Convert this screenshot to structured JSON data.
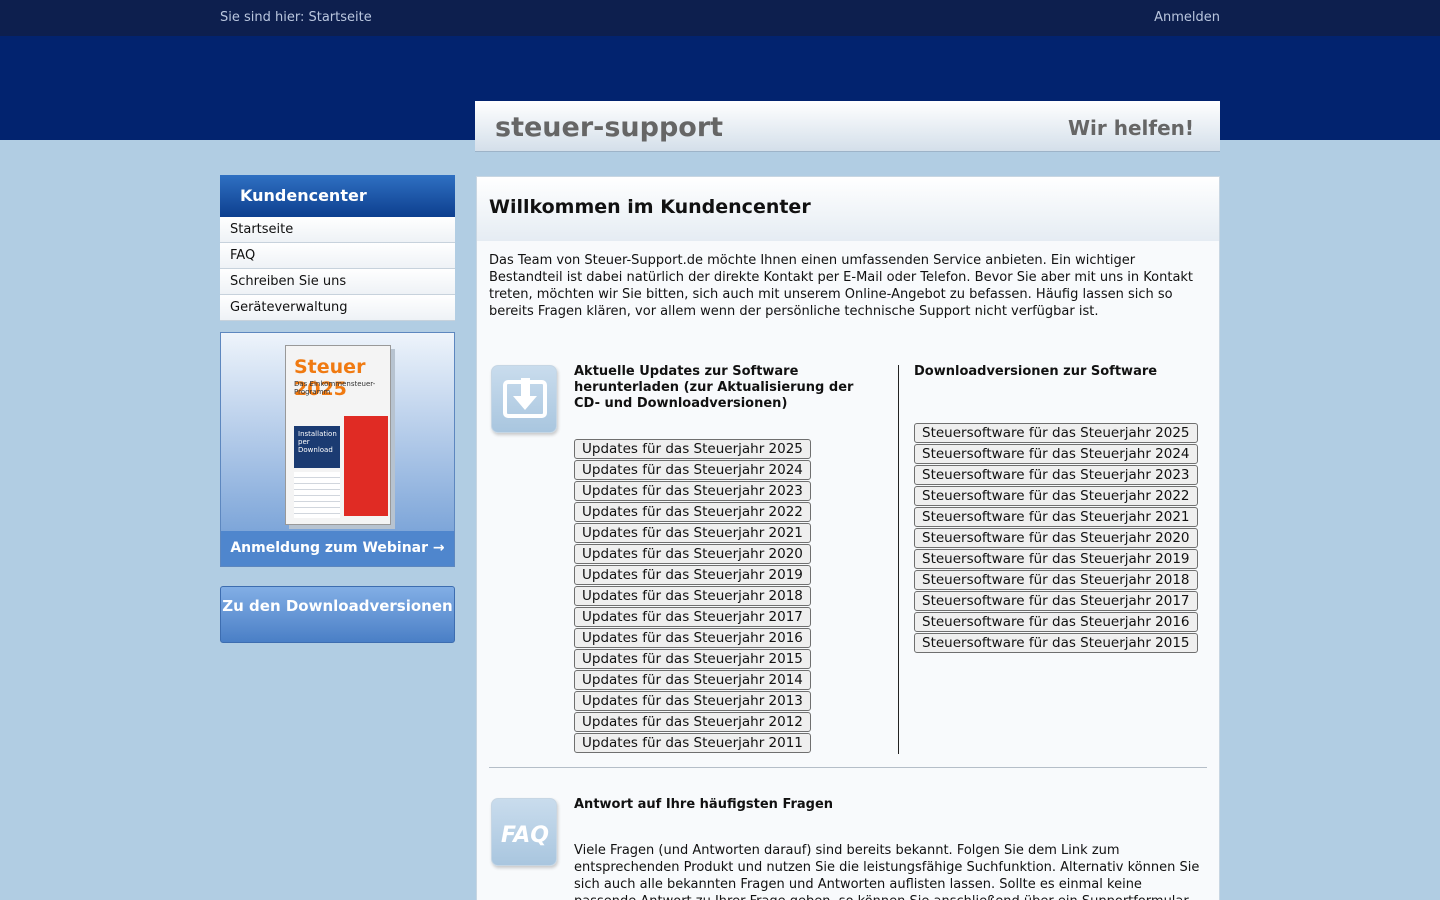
{
  "topbar": {
    "breadcrumb": "Sie sind hier: Startseite",
    "login": "Anmelden"
  },
  "brand": {
    "name": "steuer-support",
    "slogan": "Wir helfen!"
  },
  "sidebar": {
    "title": "Kundencenter",
    "items": [
      {
        "label": "Startseite"
      },
      {
        "label": "FAQ"
      },
      {
        "label": "Schreiben Sie uns"
      },
      {
        "label": "Geräteverwaltung"
      }
    ],
    "webinar": {
      "book_title": "Steuer 2025",
      "book_subtitle": "Das Einkommensteuer-Programm",
      "book_badge": "Installation per Download",
      "label": "Anmeldung zum Webinar →"
    },
    "download_button": "Zu den Downloadversionen"
  },
  "main": {
    "title": "Willkommen im Kundencenter",
    "intro": "Das Team von Steuer-Support.de möchte Ihnen einen umfassenden Service anbieten. Ein wichtiger Bestandteil ist dabei natürlich der direkte Kontakt per E-Mail oder Telefon. Bevor Sie aber mit uns in Kontakt treten, möchten wir Sie bitten, sich auch mit unserem Online-Angebot zu befassen. Häufig lassen sich so bereits Fragen klären, vor allem wenn der persönliche technische Support nicht verfügbar ist.",
    "updates": {
      "heading": "Aktuelle Updates zur Software herunterladen (zur Aktualisierung der CD- und Downloadversionen)",
      "buttons": [
        "Updates für das Steuerjahr 2025",
        "Updates für das Steuerjahr 2024",
        "Updates für das Steuerjahr 2023",
        "Updates für das Steuerjahr 2022",
        "Updates für das Steuerjahr 2021",
        "Updates für das Steuerjahr 2020",
        "Updates für das Steuerjahr 2019",
        "Updates für das Steuerjahr 2018",
        "Updates für das Steuerjahr 2017",
        "Updates für das Steuerjahr 2016",
        "Updates für das Steuerjahr 2015",
        "Updates für das Steuerjahr 2014",
        "Updates für das Steuerjahr 2013",
        "Updates für das Steuerjahr 2012",
        "Updates für das Steuerjahr 2011"
      ]
    },
    "downloads": {
      "heading": "Downloadversionen zur Software",
      "buttons": [
        "Steuersoftware für das Steuerjahr 2025",
        "Steuersoftware für das Steuerjahr 2024",
        "Steuersoftware für das Steuerjahr 2023",
        "Steuersoftware für das Steuerjahr 2022",
        "Steuersoftware für das Steuerjahr 2021",
        "Steuersoftware für das Steuerjahr 2020",
        "Steuersoftware für das Steuerjahr 2019",
        "Steuersoftware für das Steuerjahr 2018",
        "Steuersoftware für das Steuerjahr 2017",
        "Steuersoftware für das Steuerjahr 2016",
        "Steuersoftware für das Steuerjahr 2015"
      ]
    },
    "faq": {
      "icon_text": "FAQ",
      "heading": "Antwort auf Ihre häufigsten Fragen",
      "text": "Viele Fragen (und Antworten darauf) sind bereits bekannt. Folgen Sie dem Link zum entsprechenden Produkt und nutzen Sie die leistungsfähige Suchfunktion. Alternativ können Sie sich auch alle bekannten Fragen und Antworten auflisten lassen. Sollte es einmal keine passende Antwort zu Ihrer Frage geben, so können Sie anschließend über ein Supportformular"
    }
  },
  "colors": {
    "topbar": "#0d1f4e",
    "header_band": "#02236f",
    "page_bg": "#b1cde3",
    "sidebar_title": "#1a58ab",
    "accent_button": "#4f86cd"
  }
}
